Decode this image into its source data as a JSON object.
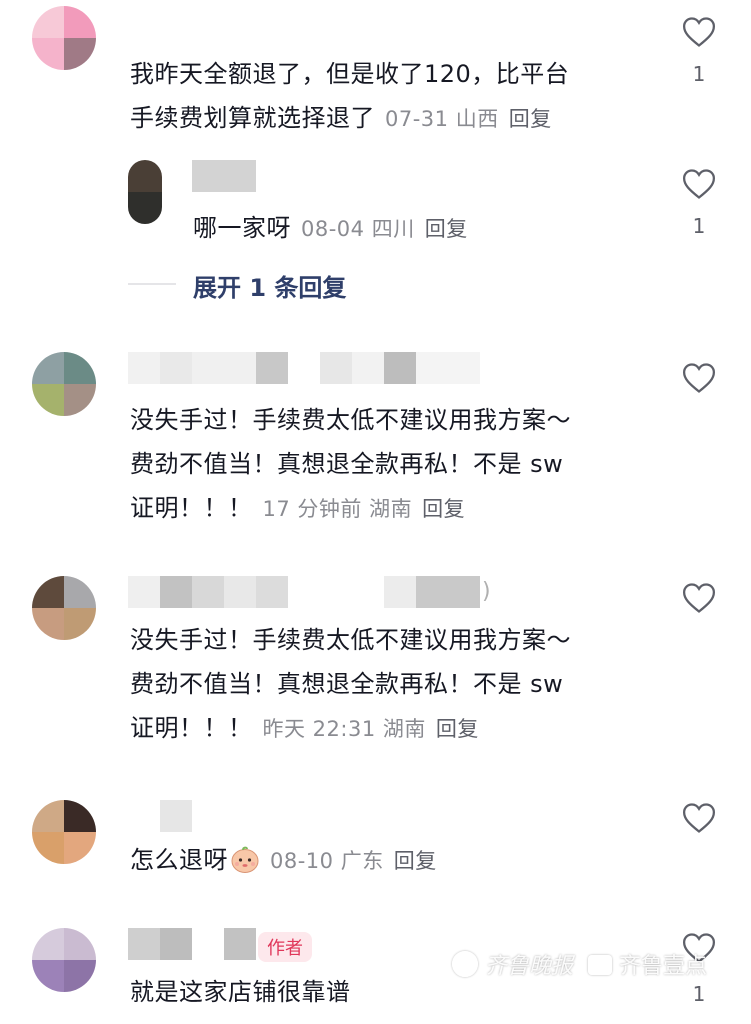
{
  "comments": [
    {
      "id": "c1",
      "text_lines": [
        "我昨天全额退了，但是收了120，比平台",
        "手续费划算就选择退了"
      ],
      "meta": "07-31 山西",
      "reply": "回复",
      "likes": "1"
    },
    {
      "id": "c1r",
      "text_lines": [
        "哪一家呀"
      ],
      "meta": "08-04 四川",
      "reply": "回复",
      "likes": "1"
    },
    {
      "id": "c2",
      "text_lines": [
        "没失手过！手续费太低不建议用我方案～",
        "费劲不值当！真想退全款再私！不是 sw",
        "证明！！！"
      ],
      "meta": "17 分钟前 湖南",
      "reply": "回复"
    },
    {
      "id": "c3",
      "text_lines": [
        "没失手过！手续费太低不建议用我方案～",
        "费劲不值当！真想退全款再私！不是 sw",
        "证明！！！"
      ],
      "meta": "昨天 22:31 湖南",
      "reply": "回复"
    },
    {
      "id": "c4",
      "text_lines": [
        "怎么退呀"
      ],
      "meta": "08-10 广东",
      "reply": "回复"
    },
    {
      "id": "c5",
      "text_lines": [
        "就是这家店铺很靠谱"
      ],
      "author_tag": "作者",
      "likes": "1"
    }
  ],
  "expand_replies": "展开 1 条回复",
  "name_suffix": ")",
  "watermark": {
    "paper": "齐鲁晚报",
    "app": "齐鲁壹点"
  },
  "icons": {
    "like": "heart-outline-icon",
    "emoji": "baby-face-emoji-icon"
  },
  "colors": {
    "text": "#161823",
    "meta": "#8a8b91",
    "link": "#2f3f6a",
    "author_tag": "#e0375a"
  }
}
